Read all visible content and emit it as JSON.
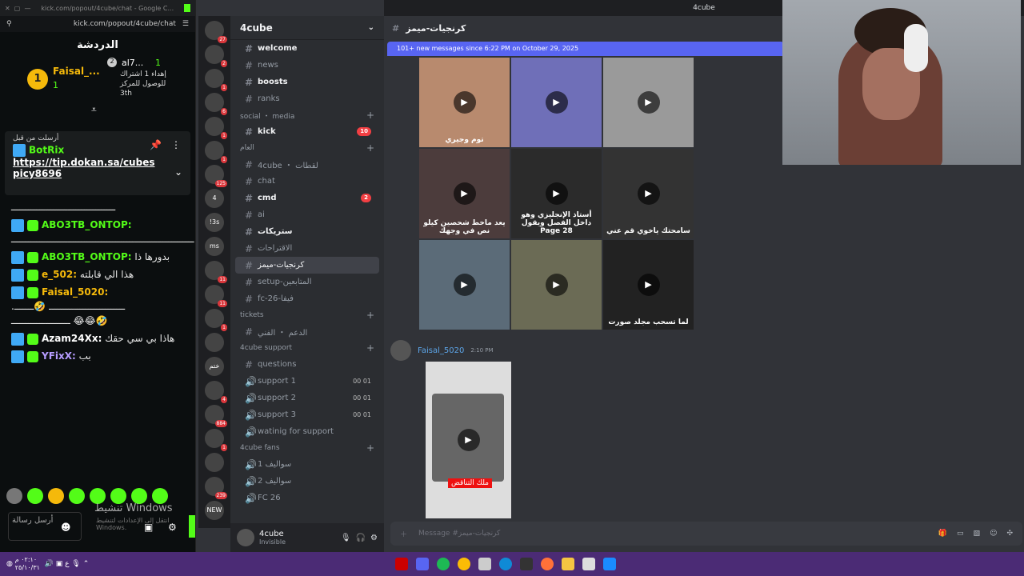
{
  "kick": {
    "window_url": "kick.com/popout/4cube/chat - Google C...",
    "address": "kick.com/popout/4cube/chat",
    "chat_title": "الدردشة",
    "leaderboard": {
      "first": "Faisal_...",
      "first_count": "1",
      "second": "al7...",
      "second_count": "1",
      "gift_text": "إهداء 1 اشتراك",
      "reach_text": "للوصول للمركز",
      "rank": "3th"
    },
    "pinned": {
      "header": "أرسلت من قبل",
      "user": "BotRix",
      "link": "https://tip.dokan.sa/cubespicy8696"
    },
    "messages": [
      {
        "user": "",
        "text": "ـــــــــــــــــــــــــــــــــــــ",
        "color": "#ffffff"
      },
      {
        "user": "ABO3TB_ONTOP:",
        "text": "ـــــــــــــــــــــــــــــــــــــــــــــــــــــــــــــــــ",
        "color": "#53fc18"
      },
      {
        "user": "ABO3TB_ONTOP:",
        "text": "بدورها ذا",
        "color": "#53fc18"
      },
      {
        "user": "e_502:",
        "text": "هذا الي قابلته",
        "color": "#f5b90b"
      },
      {
        "user": "Faisal_5020:",
        "text": "ـــــــــــــــــــــــــــ 🤣ـــــــ. ـــــــــــــــــــــ 😂😂🤣",
        "color": "#f5b90b"
      },
      {
        "user": "Azam24Xx:",
        "text": "هاذا بي سي حقك",
        "color": "#ffffff"
      },
      {
        "user": "YFixX:",
        "text": "بب",
        "color": "#b69cff"
      }
    ],
    "input_placeholder": "أرسل رسالة",
    "watermark": "تنشيط Windows",
    "watermark_sub": "انتقل إلى الإعدادات لتنشيط Windows."
  },
  "servers": [
    {
      "label": "",
      "badge": "27"
    },
    {
      "label": "",
      "badge": "2"
    },
    {
      "label": "",
      "badge": "1"
    },
    {
      "label": "",
      "badge": "6"
    },
    {
      "label": "",
      "badge": "1"
    },
    {
      "label": "",
      "badge": "1"
    },
    {
      "label": "",
      "badge": "125"
    },
    {
      "label": "4",
      "badge": ""
    },
    {
      "label": "!3s",
      "badge": ""
    },
    {
      "label": "ms",
      "badge": ""
    },
    {
      "label": "",
      "badge": "11"
    },
    {
      "label": "",
      "badge": "11"
    },
    {
      "label": "",
      "badge": "1"
    },
    {
      "label": "",
      "badge": ""
    },
    {
      "label": "ختم",
      "badge": ""
    },
    {
      "label": "",
      "badge": "4"
    },
    {
      "label": "",
      "badge": "884"
    },
    {
      "label": "",
      "badge": "1"
    },
    {
      "label": "",
      "badge": ""
    },
    {
      "label": "",
      "badge": "239"
    },
    {
      "label": "NEW",
      "badge": ""
    }
  ],
  "discord": {
    "top_title": "4cube",
    "server_name": "4cube",
    "channels": [
      {
        "type": "ch",
        "name": "welcome",
        "bright": true
      },
      {
        "type": "ch",
        "name": "news"
      },
      {
        "type": "ch",
        "name": "boosts",
        "bright": true
      },
      {
        "type": "ch",
        "name": "ranks"
      },
      {
        "type": "cat",
        "name": "social ・ media"
      },
      {
        "type": "ch",
        "name": "kick",
        "bright": true,
        "badge": "10"
      },
      {
        "type": "cat",
        "name": "العام"
      },
      {
        "type": "ch",
        "name": "4cube ・ لقطات"
      },
      {
        "type": "ch",
        "name": "chat"
      },
      {
        "type": "ch",
        "name": "cmd",
        "bright": true,
        "badge": "2"
      },
      {
        "type": "ch",
        "name": "ai"
      },
      {
        "type": "ch",
        "name": "ستريكات",
        "bright": true
      },
      {
        "type": "ch",
        "name": "الاقتراحات"
      },
      {
        "type": "ch",
        "name": "كرنجيات-ميمز",
        "selected": true
      },
      {
        "type": "ch",
        "name": "setup-المتابعين"
      },
      {
        "type": "ch",
        "name": "fc-26-فيفا"
      },
      {
        "type": "cat",
        "name": "tickets"
      },
      {
        "type": "ch",
        "name": "الدعم ・ الفني"
      },
      {
        "type": "cat",
        "name": "4cube support"
      },
      {
        "type": "ch",
        "name": "questions"
      },
      {
        "type": "vc",
        "name": "support 1",
        "count": "00 01"
      },
      {
        "type": "vc",
        "name": "support 2",
        "count": "00 01"
      },
      {
        "type": "vc",
        "name": "support 3",
        "count": "00 01"
      },
      {
        "type": "vc",
        "name": "watinig for support"
      },
      {
        "type": "cat",
        "name": "4cube fans"
      },
      {
        "type": "vc",
        "name": "سواليف 1"
      },
      {
        "type": "vc",
        "name": "سواليف 2"
      },
      {
        "type": "vc",
        "name": "FC 26"
      }
    ],
    "user": {
      "name": "4cube",
      "status": "Invisible"
    },
    "channel_title": "كرنجيات-ميمز",
    "new_messages": "101+ new messages since 6:22 PM on October 29, 2025",
    "tiles": [
      "توم وجيري",
      "",
      "",
      "يعد ماخط شحصين كيلو نص في وجهك",
      "أستاذ الإنجليزي وهو داخل الفصل ويقول Page 28",
      "سامحتك ياخوي قم عني",
      "",
      "",
      "لما تسحب مجلد صورت"
    ],
    "author": "Faisal_5020",
    "time": "2:10 PM",
    "video_caption": "ملك التناقض",
    "composer_placeholder": "Message #كرنجيات-ميمز"
  },
  "taskbar": {
    "time": "٠٢:١٠ م",
    "date": "٢٥/١٠/٣١"
  }
}
